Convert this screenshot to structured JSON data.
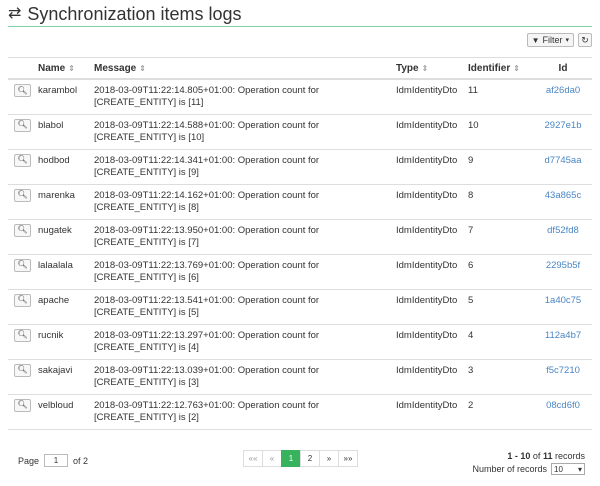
{
  "header": {
    "title": "Synchronization items logs",
    "icon": "exchange-icon"
  },
  "toolbar": {
    "filter_label": "Filter"
  },
  "table": {
    "columns": [
      "Name",
      "Message",
      "Type",
      "Identifier",
      "Id"
    ],
    "rows": [
      {
        "name": "karambol",
        "message": "2018-03-09T11:22:14.805+01:00: Operation count for [CREATE_ENTITY] is [11]",
        "type": "IdmIdentityDto",
        "identifier": "11",
        "id": "af26da0"
      },
      {
        "name": "blabol",
        "message": "2018-03-09T11:22:14.588+01:00: Operation count for [CREATE_ENTITY] is [10]",
        "type": "IdmIdentityDto",
        "identifier": "10",
        "id": "2927e1b"
      },
      {
        "name": "hodbod",
        "message": "2018-03-09T11:22:14.341+01:00: Operation count for [CREATE_ENTITY] is [9]",
        "type": "IdmIdentityDto",
        "identifier": "9",
        "id": "d7745aa"
      },
      {
        "name": "marenka",
        "message": "2018-03-09T11:22:14.162+01:00: Operation count for [CREATE_ENTITY] is [8]",
        "type": "IdmIdentityDto",
        "identifier": "8",
        "id": "43a865c"
      },
      {
        "name": "nugatek",
        "message": "2018-03-09T11:22:13.950+01:00: Operation count for [CREATE_ENTITY] is [7]",
        "type": "IdmIdentityDto",
        "identifier": "7",
        "id": "df52fd8"
      },
      {
        "name": "lalaalala",
        "message": "2018-03-09T11:22:13.769+01:00: Operation count for [CREATE_ENTITY] is [6]",
        "type": "IdmIdentityDto",
        "identifier": "6",
        "id": "2295b5f"
      },
      {
        "name": "apache",
        "message": "2018-03-09T11:22:13.541+01:00: Operation count for [CREATE_ENTITY] is [5]",
        "type": "IdmIdentityDto",
        "identifier": "5",
        "id": "1a40c75"
      },
      {
        "name": "rucnik",
        "message": "2018-03-09T11:22:13.297+01:00: Operation count for [CREATE_ENTITY] is [4]",
        "type": "IdmIdentityDto",
        "identifier": "4",
        "id": "112a4b7"
      },
      {
        "name": "sakajavi",
        "message": "2018-03-09T11:22:13.039+01:00: Operation count for [CREATE_ENTITY] is [3]",
        "type": "IdmIdentityDto",
        "identifier": "3",
        "id": "f5c7210"
      },
      {
        "name": "velbloud",
        "message": "2018-03-09T11:22:12.763+01:00: Operation count for [CREATE_ENTITY] is [2]",
        "type": "IdmIdentityDto",
        "identifier": "2",
        "id": "08cd6f0"
      }
    ]
  },
  "pagination": {
    "page_label": "Page",
    "current_page": "1",
    "of_label": "of 2",
    "first": "««",
    "prev": "«",
    "pages": [
      "1",
      "2"
    ],
    "next": "»",
    "last": "»»",
    "range_start": "1",
    "range_end": "10",
    "range_of": "of",
    "total": "11",
    "records_word": "records",
    "rpp_label": "Number of records",
    "rpp_value": "10"
  }
}
